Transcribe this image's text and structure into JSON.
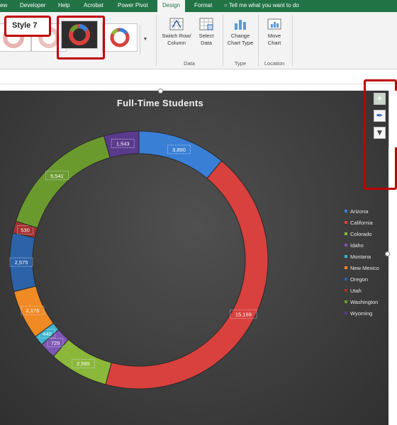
{
  "tabs": [
    {
      "label": "ew",
      "active": false
    },
    {
      "label": "Developer",
      "active": false
    },
    {
      "label": "Help",
      "active": false
    },
    {
      "label": "Acrobat",
      "active": false
    },
    {
      "label": "Power Pivot",
      "active": false
    },
    {
      "label": "Design",
      "active": true
    },
    {
      "label": "Format",
      "active": false
    }
  ],
  "tell_me": "Tell me what you want to do",
  "chart_styles": {
    "tooltip": "Style 7",
    "items": [
      "chart-style-6",
      "chart-style-7",
      "chart-style-8"
    ],
    "selected": "chart-style-7"
  },
  "ribbon_groups": {
    "data": {
      "label": "Data",
      "switch_row_column": {
        "line1": "Switch Row/",
        "line2": "Column"
      },
      "select_data": {
        "line1": "Select",
        "line2": "Data"
      }
    },
    "type": {
      "label": "Type",
      "change_chart_type": {
        "line1": "Change",
        "line2": "Chart Type"
      }
    },
    "location": {
      "label": "Location",
      "move_chart": {
        "line1": "Move",
        "line2": "Chart"
      }
    }
  },
  "accent_colors": {
    "excel_green": "#217346",
    "callout_red": "#c00000"
  },
  "chart_data": {
    "type": "pie",
    "variant": "doughnut",
    "title": "Full-Time Students",
    "categories": [
      "Arizona",
      "California",
      "Colorado",
      "Idaho",
      "Montana",
      "New Mexico",
      "Oregon",
      "Utah",
      "Washington",
      "Wyoming"
    ],
    "values": [
      3890,
      15169,
      2595,
      729,
      440,
      2176,
      2575,
      530,
      5541,
      1543
    ],
    "labels": [
      "3,890",
      "15,169",
      "2,595",
      "729",
      "440",
      "2,176",
      "2,575",
      "530",
      "5,541",
      "1,543"
    ],
    "colors": [
      "#3a7fd6",
      "#d8413d",
      "#8bb83a",
      "#7e56b3",
      "#3fb4cc",
      "#f08a24",
      "#2b62a8",
      "#a63030",
      "#6a9a2e",
      "#5a3a8c"
    ],
    "legend_position": "right"
  }
}
